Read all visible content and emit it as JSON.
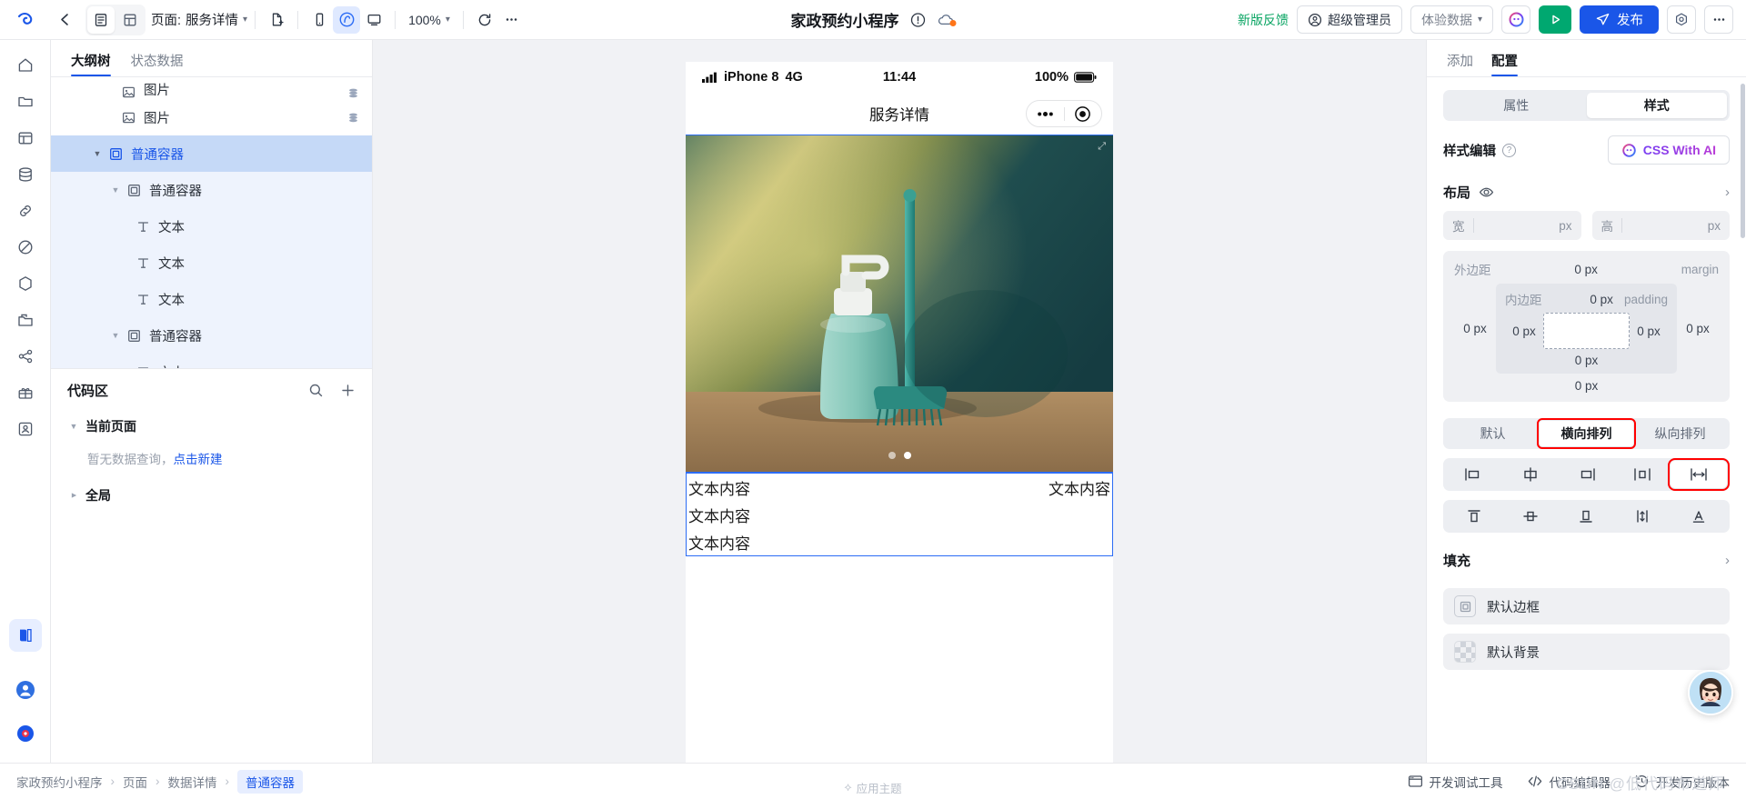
{
  "toolbar": {
    "back_icon": "arrow-left-icon",
    "outline_icon": "outline-view-icon",
    "grid_icon": "grid-view-icon",
    "page_prefix": "页面:",
    "page_name": "服务详情",
    "new_page_icon": "new-page-icon",
    "mobile_icon": "mobile-preview-icon",
    "wechat_icon": "wechat-preview-icon",
    "desktop_icon": "desktop-preview-icon",
    "zoom_level": "100%",
    "refresh_icon": "refresh-icon",
    "more_icon": "more-horizontal-icon",
    "app_title": "家政预约小程序",
    "warning_icon": "warning-circle-icon",
    "cloud_icon": "cloud-status-icon",
    "feedback_label": "新版反馈",
    "role_label": "超级管理员",
    "role_icon": "user-circle-icon",
    "data_env_label": "体验数据",
    "ai_icon": "ai-assistant-icon",
    "run_icon": "play-icon",
    "publish_label": "发布",
    "publish_icon": "send-icon",
    "settings_icon": "settings-hex-icon",
    "overflow_icon": "more-horizontal-icon"
  },
  "rail": {
    "items": [
      {
        "name": "home-icon"
      },
      {
        "name": "folder-icon"
      },
      {
        "name": "layers-icon"
      },
      {
        "name": "database-icon"
      },
      {
        "name": "link-icon"
      },
      {
        "name": "shield-icon"
      },
      {
        "name": "cube-icon"
      },
      {
        "name": "briefcase-icon"
      },
      {
        "name": "share-icon"
      },
      {
        "name": "gift-icon"
      },
      {
        "name": "contacts-icon"
      }
    ],
    "bottom_items": [
      {
        "name": "book-icon"
      },
      {
        "name": "account-icon"
      },
      {
        "name": "help-icon"
      }
    ]
  },
  "left_panel": {
    "tabs": [
      {
        "label": "大纲树",
        "active": true
      },
      {
        "label": "状态数据",
        "active": false
      }
    ],
    "tree": [
      {
        "label": "图片",
        "icon": "image-icon",
        "depth": 2,
        "state": "clipped",
        "badge": "data-bound-icon"
      },
      {
        "label": "图片",
        "icon": "image-icon",
        "depth": 2,
        "state": "normal",
        "badge": "data-bound-icon"
      },
      {
        "label": "普通容器",
        "icon": "container-icon",
        "depth": 1,
        "state": "selected",
        "expander": "▼"
      },
      {
        "label": "普通容器",
        "icon": "container-icon",
        "depth": 2,
        "state": "inrange",
        "expander": "▼"
      },
      {
        "label": "文本",
        "icon": "text-icon",
        "depth": 3,
        "state": "inrange"
      },
      {
        "label": "文本",
        "icon": "text-icon",
        "depth": 3,
        "state": "inrange"
      },
      {
        "label": "文本",
        "icon": "text-icon",
        "depth": 3,
        "state": "inrange"
      },
      {
        "label": "普通容器",
        "icon": "container-icon",
        "depth": 2,
        "state": "inrange",
        "expander": "▼"
      },
      {
        "label": "文本",
        "icon": "text-icon",
        "depth": 3,
        "state": "inrange"
      }
    ],
    "code_area": {
      "title": "代码区",
      "search_icon": "search-icon",
      "add_icon": "plus-icon",
      "current_page_label": "当前页面",
      "empty_text": "暂无数据查询，",
      "empty_link": "点击新建",
      "global_label": "全局"
    }
  },
  "canvas": {
    "device": {
      "signal_icon": "signal-bars-icon",
      "carrier": "iPhone 8",
      "network": "4G",
      "time": "11:44",
      "battery_text": "100%",
      "battery_icon": "battery-full-icon"
    },
    "nav_title": "服务详情",
    "capsule": {
      "more_icon": "more-dots-icon",
      "target_icon": "target-circle-icon"
    },
    "hero": {
      "expand_icon": "expand-icon",
      "dots": 2,
      "active_dot": 1
    },
    "texts": {
      "row_left": "文本内容",
      "row_right": "文本内容",
      "line2": "文本内容",
      "line3": "文本内容"
    }
  },
  "right_panel": {
    "tabs": [
      {
        "label": "添加",
        "active": false
      },
      {
        "label": "配置",
        "active": true
      }
    ],
    "segment": [
      {
        "label": "属性",
        "active": false
      },
      {
        "label": "样式",
        "active": true
      }
    ],
    "style_edit": {
      "label": "样式编辑",
      "help_icon": "question-icon",
      "ai_button": "CSS With AI",
      "ai_icon": "css-ai-icon"
    },
    "layout": {
      "title": "布局",
      "eye_icon": "eye-icon",
      "chevron_icon": "chevron-right-icon",
      "width_label": "宽",
      "width_value": "",
      "width_unit": "px",
      "height_label": "高",
      "height_value": "",
      "height_unit": "px",
      "margin_label": "外边距",
      "margin_en": "margin",
      "margin_top": "0 px",
      "margin_right": "0 px",
      "margin_bottom": "0 px",
      "margin_left": "0 px",
      "padding_label": "内边距",
      "padding_en": "padding",
      "padding_top": "0 px",
      "padding_right": "0 px",
      "padding_bottom": "0 px",
      "padding_left": "0 px"
    },
    "direction": [
      {
        "label": "默认",
        "active": false,
        "highlight": false
      },
      {
        "label": "横向排列",
        "active": true,
        "highlight": true
      },
      {
        "label": "纵向排列",
        "active": false,
        "highlight": false
      }
    ],
    "justify_icons": [
      {
        "name": "justify-start-icon",
        "active": false
      },
      {
        "name": "justify-center-icon",
        "active": false
      },
      {
        "name": "justify-end-icon",
        "active": false
      },
      {
        "name": "justify-space-around-icon",
        "active": false
      },
      {
        "name": "justify-space-between-icon",
        "active": true,
        "highlight": true
      }
    ],
    "align_icons": [
      {
        "name": "align-top-icon",
        "active": false
      },
      {
        "name": "align-middle-icon",
        "active": false
      },
      {
        "name": "align-bottom-icon",
        "active": false
      },
      {
        "name": "align-stretch-icon",
        "active": false
      },
      {
        "name": "align-baseline-icon",
        "active": false
      }
    ],
    "fill": {
      "title": "填充",
      "chevron_icon": "chevron-right-icon",
      "items": [
        {
          "label": "默认边框",
          "swatch": "border",
          "icon": "border-swatch-icon"
        },
        {
          "label": "默认背景",
          "swatch": "checker",
          "icon": "background-swatch-icon"
        }
      ]
    },
    "avatar_icon": "assistant-avatar-icon"
  },
  "bottom_bar": {
    "breadcrumb": [
      {
        "label": "家政预约小程序",
        "current": false
      },
      {
        "label": "页面",
        "current": false
      },
      {
        "label": "数据详情",
        "current": false
      },
      {
        "label": "普通容器",
        "current": true
      }
    ],
    "separator": "›",
    "actions": [
      {
        "label": "开发调试工具",
        "icon": "devtools-icon"
      },
      {
        "label": "代码编辑器",
        "icon": "code-editor-icon"
      },
      {
        "label": "开发历史版本",
        "icon": "history-icon"
      }
    ],
    "theme_label": "应用主题",
    "theme_icon": "theme-icon",
    "watermark": "CSDN @低代码布道师"
  },
  "colors": {
    "accent_blue": "#1a56e8",
    "publish_blue": "#1a56e8",
    "run_green": "#00a870",
    "feedback_green": "#0aa563",
    "highlight_red": "#ff0000",
    "selection_blue": "#c5d9f7"
  }
}
